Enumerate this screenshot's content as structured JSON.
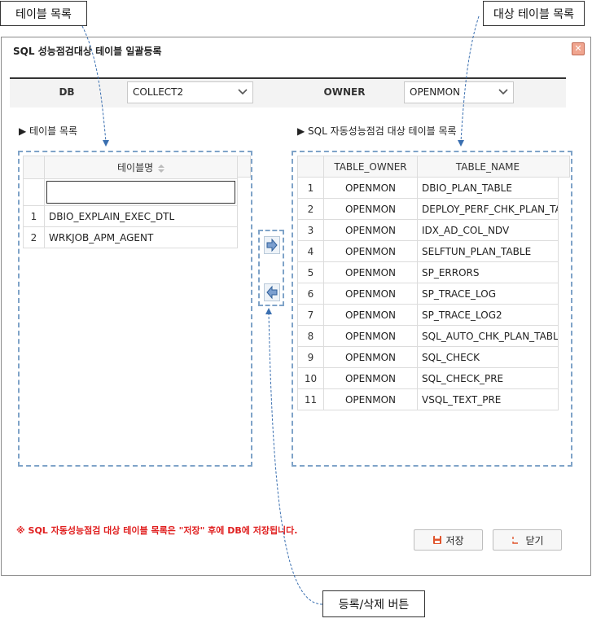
{
  "annotations": {
    "table_list": "테이블 목록",
    "target_table_list": "대상 테이블 목록",
    "register_delete_buttons": "등록/삭제 버튼"
  },
  "dialog": {
    "title": "SQL 성능점검대상 테이블 일괄등록",
    "close_icon": "close-icon"
  },
  "filters": {
    "db_label": "DB",
    "db_value": "COLLECT2",
    "owner_label": "OWNER",
    "owner_value": "OPENMON"
  },
  "left_panel": {
    "title": "▶ 테이블 목록",
    "column_header": "테이블명",
    "filter_value": "",
    "rows": [
      {
        "no": "1",
        "name": "DBIO_EXPLAIN_EXEC_DTL"
      },
      {
        "no": "2",
        "name": "WRKJOB_APM_AGENT"
      }
    ]
  },
  "right_panel": {
    "title": "▶ SQL 자동성능점검 대상 테이블 목록",
    "headers": {
      "owner": "TABLE_OWNER",
      "name": "TABLE_NAME"
    },
    "rows": [
      {
        "no": "1",
        "owner": "OPENMON",
        "name": "DBIO_PLAN_TABLE"
      },
      {
        "no": "2",
        "owner": "OPENMON",
        "name": "DEPLOY_PERF_CHK_PLAN_TABL"
      },
      {
        "no": "3",
        "owner": "OPENMON",
        "name": "IDX_AD_COL_NDV"
      },
      {
        "no": "4",
        "owner": "OPENMON",
        "name": "SELFTUN_PLAN_TABLE"
      },
      {
        "no": "5",
        "owner": "OPENMON",
        "name": "SP_ERRORS"
      },
      {
        "no": "6",
        "owner": "OPENMON",
        "name": "SP_TRACE_LOG"
      },
      {
        "no": "7",
        "owner": "OPENMON",
        "name": "SP_TRACE_LOG2"
      },
      {
        "no": "8",
        "owner": "OPENMON",
        "name": "SQL_AUTO_CHK_PLAN_TABLE"
      },
      {
        "no": "9",
        "owner": "OPENMON",
        "name": "SQL_CHECK"
      },
      {
        "no": "10",
        "owner": "OPENMON",
        "name": "SQL_CHECK_PRE"
      },
      {
        "no": "11",
        "owner": "OPENMON",
        "name": "VSQL_TEXT_PRE"
      }
    ]
  },
  "move_buttons": {
    "add_icon": "arrow-right-icon",
    "remove_icon": "arrow-left-icon"
  },
  "note": "※ SQL 자동성능점검 대상 테이블 목록은 \"저장\" 후에 DB에 저장됩니다.",
  "buttons": {
    "save": "저장",
    "close": "닫기"
  },
  "colors": {
    "accent_dash": "#7fa3c8",
    "note_red": "#e02020",
    "close_button": "#f0a58f"
  }
}
